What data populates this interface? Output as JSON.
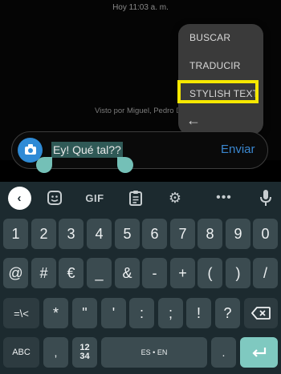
{
  "chat": {
    "timestamp": "Hoy 11:03 a. m.",
    "seen_by": "Visto por Miguel, Pedro Delgi"
  },
  "context_menu": {
    "items": [
      "BUSCAR",
      "TRADUCIR",
      "STYLISH TEXT"
    ],
    "highlighted_item": "STYLISH TEXT",
    "highlight_color": "#f6e800"
  },
  "composer": {
    "selected_text": "Ey! Qué tal??",
    "send_label": "Enviar",
    "camera_icon": "camera-icon",
    "accent_color": "#2f8bd6"
  },
  "keyboard": {
    "toolbar": {
      "icons": [
        "back-arrow-icon",
        "sticker-icon",
        "gif",
        "clipboard-icon",
        "gear-icon",
        "more-icon",
        "mic-icon"
      ],
      "gif_label": "GIF"
    },
    "row1": [
      "1",
      "2",
      "3",
      "4",
      "5",
      "6",
      "7",
      "8",
      "9",
      "0"
    ],
    "row2": [
      "@",
      "#",
      "€",
      "_",
      "&",
      "-",
      "+",
      "(",
      ")",
      "/"
    ],
    "row3": [
      "=\\<",
      "*",
      "\"",
      "'",
      ":",
      ";",
      "!",
      "?"
    ],
    "row4": {
      "abc": "ABC",
      "comma": ",",
      "num_top": "12",
      "num_bottom": "34",
      "space": "ES • EN",
      "period": "."
    }
  }
}
